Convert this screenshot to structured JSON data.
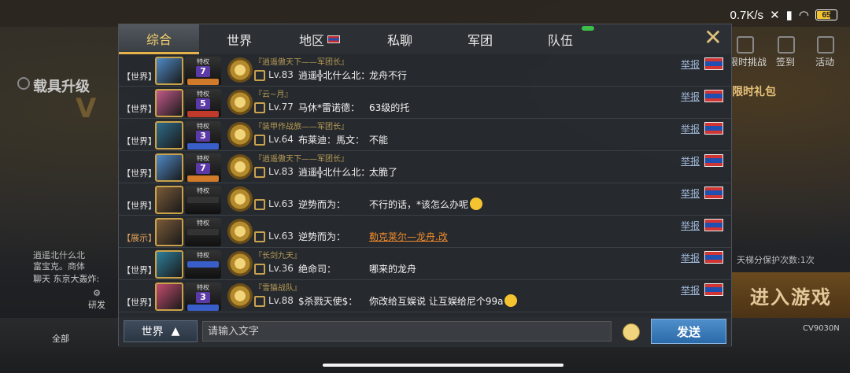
{
  "status_bar": {
    "net_speed": "0.7K/s",
    "battery": "65",
    "battery_level": 0.65
  },
  "background": {
    "left_title": "载具升级",
    "chat_preview": [
      "逍遥北什么北",
      "富宝克。商体"
    ],
    "chat_tab": "聊天",
    "chat_preview_extra": "东京大轰炸:",
    "research": "研发",
    "right_items": [
      "限时挑战",
      "签到",
      "活动"
    ],
    "right_banner": "限时礼包",
    "protect_text": "天梯分保护次数:1次",
    "enter_game": "进入游戏",
    "all_label": "全部",
    "tank_code": "CV9030N"
  },
  "tabs": [
    {
      "label": "综合",
      "active": true
    },
    {
      "label": "世界",
      "active": false
    },
    {
      "label": "地区",
      "active": false,
      "flag": true
    },
    {
      "label": "私聊",
      "active": false
    },
    {
      "label": "军团",
      "active": false
    },
    {
      "label": "队伍",
      "active": false,
      "badge": true
    }
  ],
  "close_icon": "close-icon",
  "report_label": "举报",
  "messages": [
    {
      "channel": "【世界】",
      "team": "『逍遥傲天下——军团长』",
      "rank_num": "7",
      "lv": "Lv.83",
      "name": "逍遥╬北什么北：",
      "text": "龙舟不行",
      "emoji": false,
      "link": false,
      "avatar_color": "#4f8ac7",
      "strip_color": "#d07a2a"
    },
    {
      "channel": "【世界】",
      "team": "『云~月』",
      "rank_num": "5",
      "lv": "Lv.77",
      "name": "马休*雷诺德：",
      "text": "63级的托",
      "emoji": false,
      "link": false,
      "avatar_color": "#c25a8a",
      "strip_color": "#c0392b"
    },
    {
      "channel": "【世界】",
      "team": "『装甲作战旅——军团长』",
      "rank_num": "3",
      "lv": "Lv.64",
      "name": "布莱迪：馬文：",
      "text": "不能",
      "emoji": false,
      "link": false,
      "avatar_color": "#2e6b8a",
      "strip_color": "#3a5ec9"
    },
    {
      "channel": "【世界】",
      "team": "『逍遥傲天下——军团长』",
      "rank_num": "7",
      "lv": "Lv.83",
      "name": "逍遥╬北什么北：",
      "text": "太脆了",
      "emoji": false,
      "link": false,
      "avatar_color": "#4f8ac7",
      "strip_color": "#d07a2a"
    },
    {
      "channel": "【世界】",
      "team": "",
      "rank_num": "",
      "lv": "Lv.63",
      "name": "逆势而为：",
      "text": "不行的话，*该怎么办呢",
      "emoji": true,
      "link": false,
      "avatar_color": "#7a5a38",
      "strip_color": "#333333"
    },
    {
      "channel": "【展示】",
      "team": "",
      "rank_num": "",
      "lv": "Lv.63",
      "name": "逆势而为：",
      "text": "勒克莱尔—龙舟.改",
      "emoji": false,
      "link": true,
      "show": true,
      "avatar_color": "#7a5a38",
      "strip_color": "#333333"
    },
    {
      "channel": "【世界】",
      "team": "『长剑九天』",
      "rank_num": "",
      "lv": "Lv.36",
      "name": "绝命司：",
      "text": "哪来的龙舟",
      "emoji": false,
      "link": false,
      "avatar_color": "#2f7f9c",
      "strip_color": "#3a5ec9"
    },
    {
      "channel": "【世界】",
      "team": "『雪猫战队』",
      "rank_num": "3",
      "lv": "Lv.88",
      "name": "$杀戮天使$：",
      "text": "你改给互娱说 让互娱给尼个99a",
      "emoji": true,
      "link": false,
      "avatar_color": "#c24d6d",
      "strip_color": "#3a5ec9"
    }
  ],
  "input": {
    "channel": "世界",
    "placeholder": "请输入文字",
    "send_label": "发送"
  }
}
